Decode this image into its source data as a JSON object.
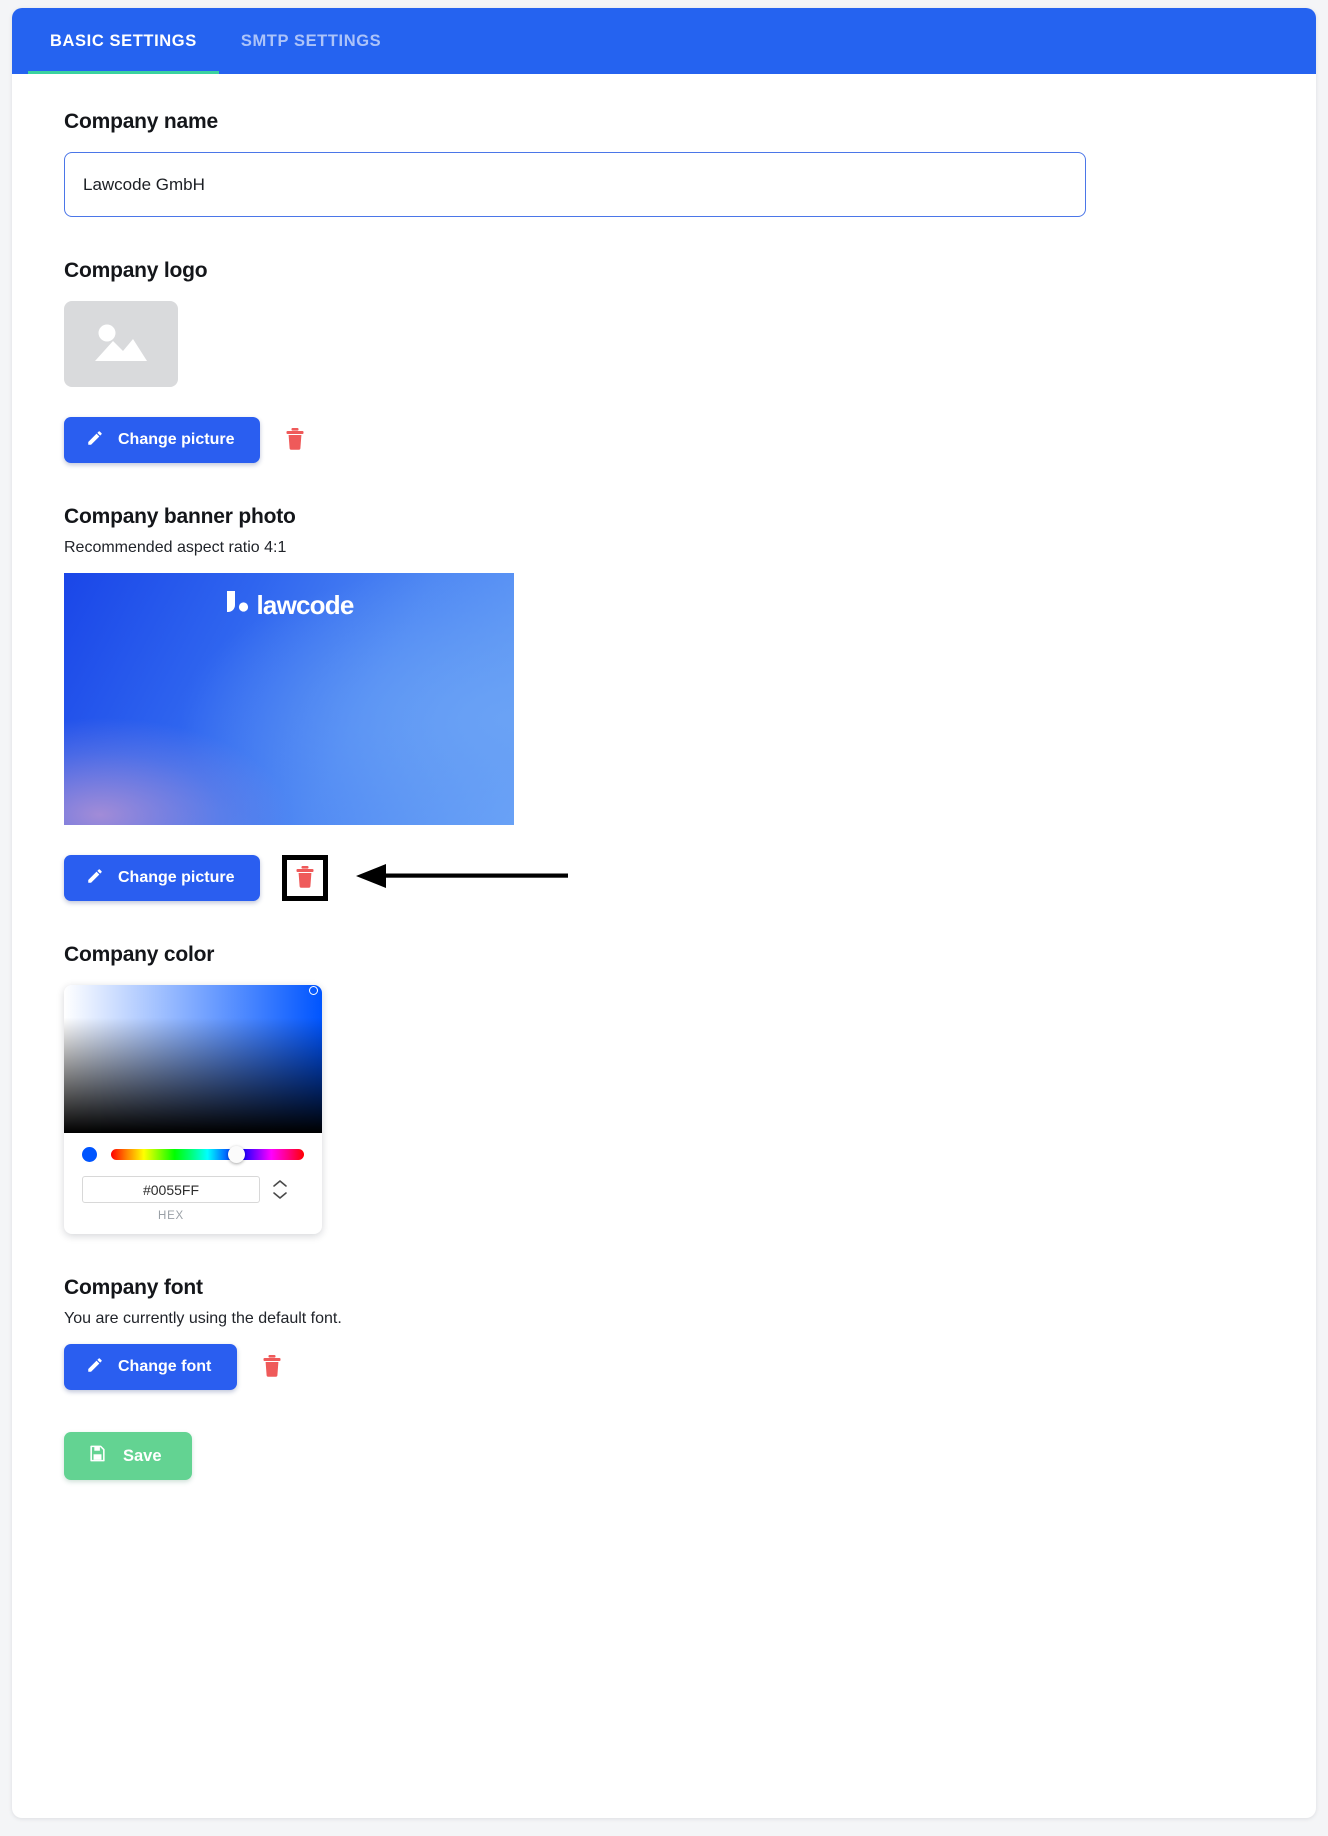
{
  "tabs": [
    {
      "label": "BASIC SETTINGS",
      "active": true
    },
    {
      "label": "SMTP SETTINGS",
      "active": false
    }
  ],
  "company_name": {
    "title": "Company name",
    "value": "Lawcode GmbH",
    "placeholder": "Company name"
  },
  "company_logo": {
    "title": "Company logo",
    "change_label": "Change picture",
    "placeholder_icon": "image-placeholder-icon",
    "delete_icon": "trash-icon"
  },
  "company_banner": {
    "title": "Company banner photo",
    "subtitle": "Recommended aspect ratio 4:1",
    "brand_text": "lawcode",
    "change_label": "Change picture",
    "delete_icon": "trash-icon",
    "highlighted": true,
    "annotation": "arrow-pointing-left"
  },
  "company_color": {
    "title": "Company color",
    "hex_value": "#0055FF",
    "hex_label": "HEX",
    "swatch_color": "#0055FF",
    "hue_position_percent": 65
  },
  "company_font": {
    "title": "Company font",
    "subtitle": "You are currently using the default font.",
    "change_label": "Change font",
    "delete_icon": "trash-icon"
  },
  "save": {
    "label": "Save",
    "color": "#63d392"
  },
  "theme": {
    "accent_blue": "#2a5ef0",
    "tab_bar_blue": "#2563f0",
    "tab_underline_green": "#3ad29f",
    "trash_red": "#ef5a5a",
    "save_green": "#63d392"
  }
}
